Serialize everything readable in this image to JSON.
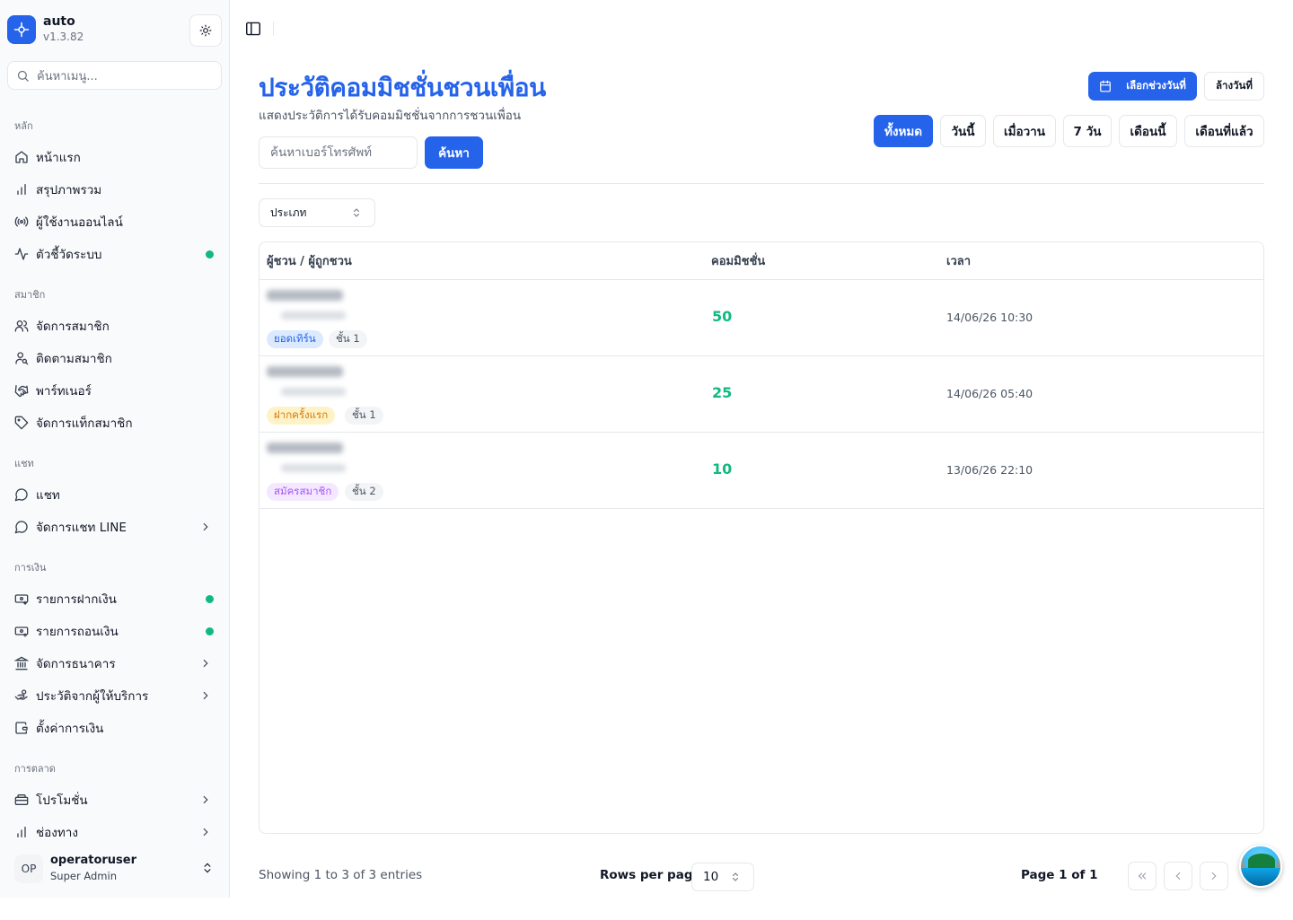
{
  "app": {
    "name": "auto",
    "version": "v1.3.82"
  },
  "sidebar": {
    "search_placeholder": "ค้นหาเมนู...",
    "sections": {
      "main": "หลัก",
      "members": "สมาชิก",
      "chat": "แชท",
      "finance": "การเงิน",
      "marketing": "การตลาด"
    },
    "items": {
      "home": "หน้าแรก",
      "overview": "สรุปภาพรวม",
      "online_users": "ผู้ใช้งานออนไลน์",
      "system_metrics": "ตัวชี้วัดระบบ",
      "manage_members": "จัดการสมาชิก",
      "track_members": "ติดตามสมาชิก",
      "partners": "พาร์ทเนอร์",
      "member_tags": "จัดการแท็กสมาชิก",
      "chat": "แชท",
      "line_chat": "จัดการแชท LINE",
      "deposits": "รายการฝากเงิน",
      "withdrawals": "รายการถอนเงิน",
      "banks": "จัดการธนาคาร",
      "provider_history": "ประวัติจากผู้ให้บริการ",
      "finance_settings": "ตั้งค่าการเงิน",
      "promotions": "โปรโมชั่น",
      "channels": "ช่องทาง"
    },
    "user": {
      "initials": "OP",
      "name": "operatoruser",
      "role": "Super Admin"
    }
  },
  "page": {
    "title": "ประวัติคอมมิชชั่นชวนเพื่อน",
    "subtitle": "แสดงประวัติการได้รับคอมมิชชั่นจากการชวนเพื่อน",
    "phone_placeholder": "ค้นหาเบอร์โทรศัพท์",
    "search_button": "ค้นหา",
    "date_range_button": "เลือกช่วงวันที่",
    "clear_date_button": "ล้างวันที่",
    "filters": {
      "all": "ทั้งหมด",
      "today": "วันนี้",
      "yesterday": "เมื่อวาน",
      "week": "7 วัน",
      "this_month": "เดือนนี้",
      "last_month": "เดือนที่แล้ว"
    },
    "type_select": "ประเภท"
  },
  "table": {
    "headers": {
      "referrer": "ผู้ชวน / ผู้ถูกชวน",
      "commission": "คอมมิชชั่น",
      "time": "เวลา"
    },
    "rows": [
      {
        "type": "ยอดเทิร์น",
        "level": "ชั้น 1",
        "amount": "50",
        "time": "14/06/26 10:30"
      },
      {
        "type": "ฝากครั้งแรก",
        "level": "ชั้น 1",
        "amount": "25",
        "time": "14/06/26 05:40"
      },
      {
        "type": "สมัครสมาชิก",
        "level": "ชั้น 2",
        "amount": "10",
        "time": "13/06/26 22:10"
      }
    ]
  },
  "footer": {
    "showing": "Showing 1 to 3 of 3 entries",
    "rows_per_page_label": "Rows per page",
    "rows_per_page_value": "10",
    "page_label": "Page 1 of 1"
  },
  "colors": {
    "accent": "#2563eb",
    "amount": "#10b981",
    "online_dot": "#10b981"
  }
}
